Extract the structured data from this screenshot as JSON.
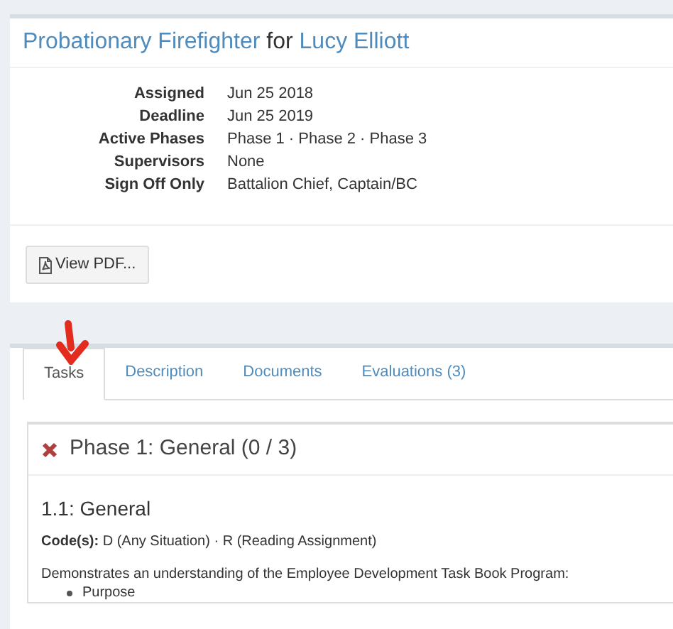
{
  "header": {
    "title_link": "Probationary Firefighter",
    "connector": "for",
    "person_link": "Lucy Elliott"
  },
  "details": [
    {
      "label": "Assigned",
      "value": "Jun 25 2018"
    },
    {
      "label": "Deadline",
      "value": "Jun 25 2019"
    },
    {
      "label": "Active Phases",
      "value": "Phase 1 · Phase 2 · Phase 3"
    },
    {
      "label": "Supervisors",
      "value": "None"
    },
    {
      "label": "Sign Off Only",
      "value": "Battalion Chief, Captain/BC"
    }
  ],
  "pdf_button": "View PDF...",
  "tabs": [
    {
      "label": "Tasks",
      "selected": true
    },
    {
      "label": "Description",
      "selected": false
    },
    {
      "label": "Documents",
      "selected": false
    },
    {
      "label": "Evaluations (3)",
      "selected": false
    }
  ],
  "phase": {
    "title": "Phase 1: General (0 / 3)",
    "complete": false,
    "task": {
      "title": "1.1: General",
      "codes": "**Code(s):** D (Any Situation) · R (Reading Assignment)",
      "description": "Demonstrates an understanding of the Employee Development Task Book Program:",
      "bullets": [
        "Purpose"
      ]
    }
  }
}
